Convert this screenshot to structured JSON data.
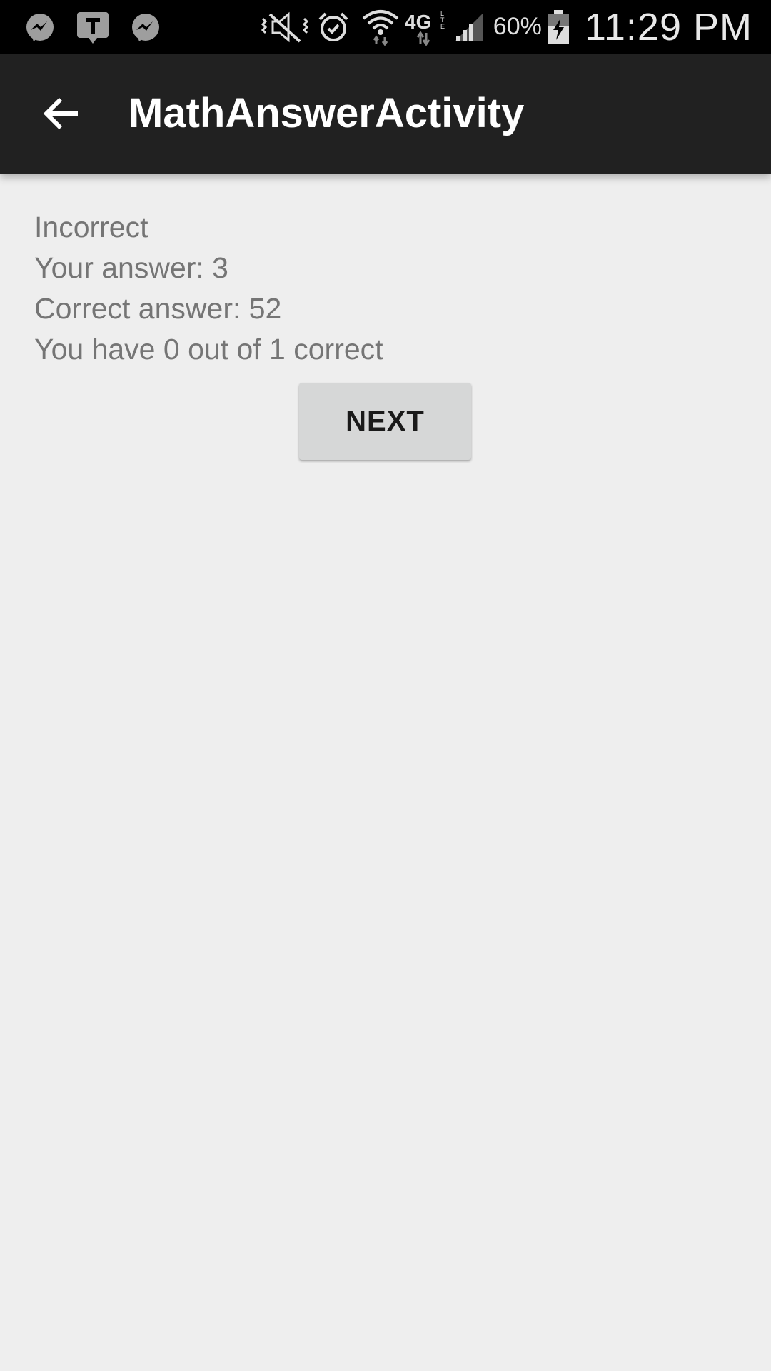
{
  "status_bar": {
    "left_icons": [
      "messenger-icon",
      "talk-icon",
      "messenger-icon"
    ],
    "right_icons": [
      "vibrate-mute-icon",
      "alarm-icon",
      "wifi-icon",
      "4g-lte-icon",
      "signal-icon",
      "battery-charging-icon"
    ],
    "network": "4G",
    "battery_percent": "60%",
    "time": "11:29 PM"
  },
  "app_bar": {
    "title": "MathAnswerActivity",
    "back_icon": "arrow-back-icon"
  },
  "result": {
    "status": "Incorrect",
    "your_answer": "Your answer: 3",
    "correct_answer": "Correct answer: 52",
    "score": "You have 0 out of 1 correct"
  },
  "actions": {
    "next_label": "NEXT"
  },
  "colors": {
    "status_bar_bg": "#000000",
    "app_bar_bg": "#212121",
    "page_bg": "#eeeeee",
    "text_secondary": "#757575",
    "button_bg": "#d6d7d7"
  }
}
